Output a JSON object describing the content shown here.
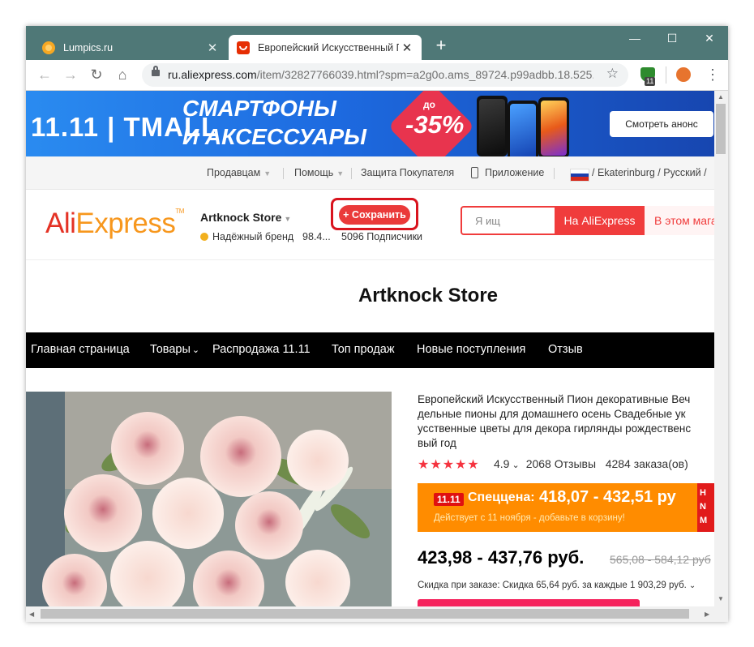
{
  "browser": {
    "tabs": [
      {
        "title": "Lumpics.ru",
        "active": false
      },
      {
        "title": "Европейский Искусственный П",
        "active": true
      }
    ],
    "url_host": "ru.aliexpress.com",
    "url_path": "/item/32827766039.html?spm=a2g0o.ams_89724.p99adbb.18.525...",
    "extension_badge": "11",
    "new_tab": "+",
    "window_controls": {
      "minimize": "—",
      "maximize": "☐",
      "close": "✕"
    }
  },
  "banner": {
    "brand": "11.11 | TMALL",
    "headline_1": "СМАРТФОНЫ",
    "headline_2": "И АКСЕССУАРЫ",
    "discount_prefix": "до",
    "discount_value": "-35%",
    "cta": "Смотреть анонс"
  },
  "toplinks": {
    "sellers": "Продавцам",
    "help": "Помощь",
    "buyer_protection": "Защита Покупателя",
    "app": "Приложение",
    "region": "/ Ekaterinburg / Русский /"
  },
  "store_header": {
    "logo_a": "Ali",
    "logo_b": "Express",
    "store_name": "Artknock Store",
    "brand_badge": "Надёжный бренд",
    "rating_pct": "98.4...",
    "followers": "5096 Подписчики",
    "save_button": "+ Сохранить",
    "search_placeholder": "Я ищ",
    "search_aliexpress": "На AliExpress",
    "search_store": "В этом магазине"
  },
  "store_title": "Artknock Store",
  "nav": {
    "items": [
      "Главная страница",
      "Товары",
      "Распродажа 11.11",
      "Топ продаж",
      "Новые поступления",
      "Отзыв"
    ]
  },
  "product": {
    "desc_lines": [
      "Европейский Искусственный Пион декоративные Веч",
      "дельные пионы для домашнего осень Свадебные ук",
      "усственные цветы для декора гирлянды рождественс",
      "вый год"
    ],
    "stars": "★★★★★",
    "rating": "4.9",
    "reviews": "2068 Отзывы",
    "orders": "4284 заказа(ов)",
    "promo_tag": "11.11",
    "promo_label": "Спеццена:",
    "promo_price": "418,07 - 432,51 ру",
    "promo_note": "Действует с 11 ноября - добавьте в корзину!",
    "promo_side": "Н\nN\nМ",
    "price": "423,98 - 437,76 руб.",
    "old_price": "565,08 - 584,12 руб",
    "order_discount": "Скидка при заказе: Скидка 65,64 руб. за каждые 1 903,29 руб."
  },
  "colors": {
    "titlebar": "#4f7877",
    "ali_red": "#f03c3c",
    "promo_orange": "#ff8c00",
    "star_red": "#f5333f"
  }
}
